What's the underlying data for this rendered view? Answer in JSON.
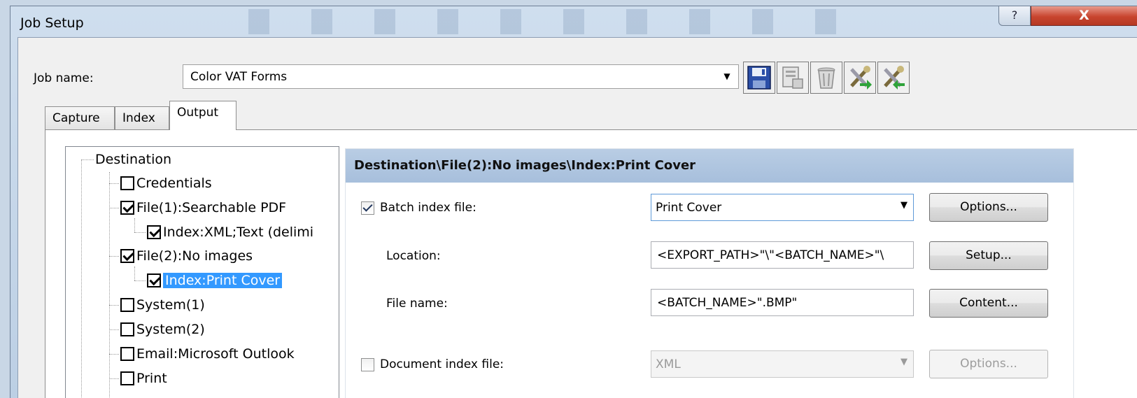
{
  "window": {
    "title": "Job Setup",
    "help_label": "?",
    "close_label": "X"
  },
  "job": {
    "label": "Job name:",
    "value": "Color VAT Forms",
    "toolbar": [
      {
        "name": "save-icon"
      },
      {
        "name": "properties-icon"
      },
      {
        "name": "delete-icon"
      },
      {
        "name": "import-tools-icon"
      },
      {
        "name": "export-tools-icon"
      }
    ]
  },
  "tabs": [
    {
      "label": "Capture"
    },
    {
      "label": "Index"
    },
    {
      "label": "Output",
      "active": true
    }
  ],
  "tree": {
    "root": "Destination",
    "items": [
      {
        "label": "Credentials",
        "checked": false,
        "level": 1
      },
      {
        "label": "File(1):Searchable PDF",
        "checked": true,
        "level": 1
      },
      {
        "label": "Index:XML;Text (delimi",
        "checked": true,
        "level": 2
      },
      {
        "label": "File(2):No images",
        "checked": true,
        "level": 1
      },
      {
        "label": "Index:Print Cover",
        "checked": true,
        "level": 2,
        "selected": true
      },
      {
        "label": "System(1)",
        "checked": false,
        "level": 1
      },
      {
        "label": "System(2)",
        "checked": false,
        "level": 1
      },
      {
        "label": "Email:Microsoft Outlook",
        "checked": false,
        "level": 1
      },
      {
        "label": "Print",
        "checked": false,
        "level": 1
      }
    ]
  },
  "detail": {
    "header": "Destination\\File(2):No images\\Index:Print Cover",
    "batch_index": {
      "label": "Batch index file:",
      "checked": true,
      "value": "Print Cover",
      "button": "Options..."
    },
    "location": {
      "label": "Location:",
      "value": "<EXPORT_PATH>\"\\\"<BATCH_NAME>\"\\",
      "button": "Setup..."
    },
    "file_name": {
      "label": "File name:",
      "value": "<BATCH_NAME>\".BMP\"",
      "button": "Content..."
    },
    "document_index": {
      "label": "Document index file:",
      "checked": false,
      "value": "XML",
      "button": "Options..."
    }
  },
  "colors": {
    "selection": "#3399ff",
    "header_bg": "#a7bfdc",
    "close_red": "#c8452f"
  }
}
